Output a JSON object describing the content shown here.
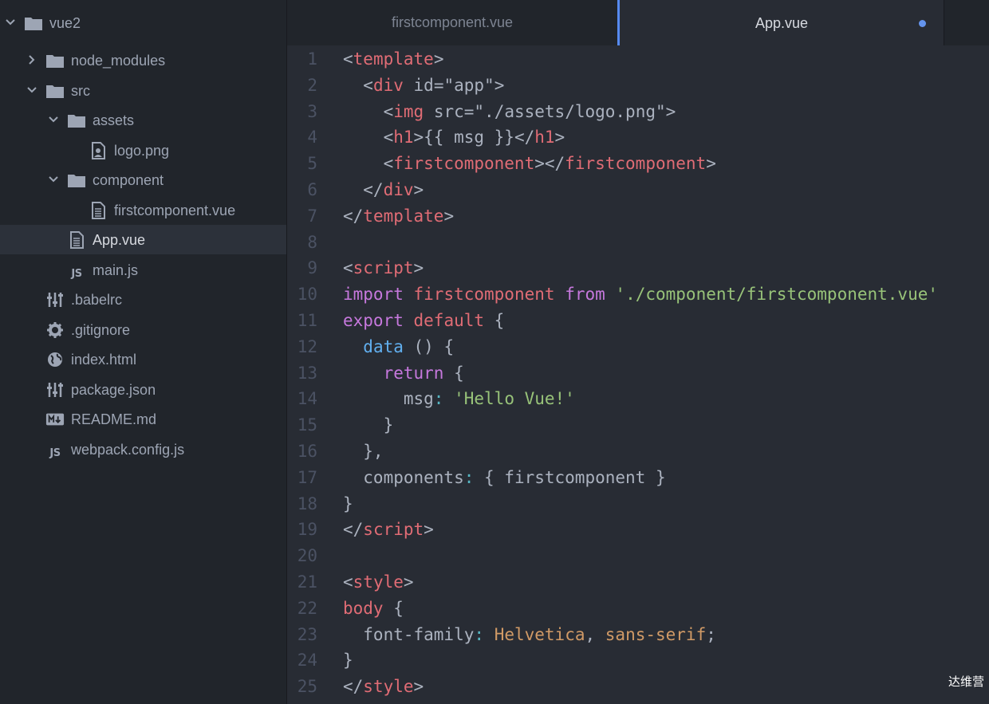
{
  "sidebar": {
    "root": {
      "label": "vue2"
    },
    "items": [
      {
        "label": "node_modules",
        "kind": "folder",
        "state": "collapsed",
        "depth": 1
      },
      {
        "label": "src",
        "kind": "folder",
        "state": "expanded",
        "depth": 1
      },
      {
        "label": "assets",
        "kind": "folder",
        "state": "expanded",
        "depth": 2
      },
      {
        "label": "logo.png",
        "kind": "image-file",
        "depth": 3
      },
      {
        "label": "component",
        "kind": "folder",
        "state": "expanded",
        "depth": 2
      },
      {
        "label": "firstcomponent.vue",
        "kind": "text-file",
        "depth": 3
      },
      {
        "label": "App.vue",
        "kind": "text-file",
        "depth": 2,
        "selected": true
      },
      {
        "label": "main.js",
        "kind": "js-file",
        "depth": 2
      },
      {
        "label": ".babelrc",
        "kind": "config-file",
        "depth": 1
      },
      {
        "label": ".gitignore",
        "kind": "gear-file",
        "depth": 1
      },
      {
        "label": "index.html",
        "kind": "globe-file",
        "depth": 1
      },
      {
        "label": "package.json",
        "kind": "config-file",
        "depth": 1
      },
      {
        "label": "README.md",
        "kind": "markdown-file",
        "depth": 1
      },
      {
        "label": "webpack.config.js",
        "kind": "js-file",
        "depth": 1
      }
    ]
  },
  "tabs": [
    {
      "label": "firstcomponent.vue",
      "active": false
    },
    {
      "label": "App.vue",
      "active": true,
      "modified": true
    }
  ],
  "editor": {
    "lines": [
      [
        [
          "t-punc",
          "<"
        ],
        [
          "t-tag",
          "template"
        ],
        [
          "t-punc",
          ">"
        ]
      ],
      [
        [
          "t-punc",
          "  <"
        ],
        [
          "t-tag",
          "div"
        ],
        [
          "t-punc",
          " "
        ],
        [
          "t-prop",
          "id"
        ],
        [
          "t-punc",
          "="
        ],
        [
          "t-punc",
          "\"app\""
        ],
        [
          "t-punc",
          ">"
        ]
      ],
      [
        [
          "t-punc",
          "    <"
        ],
        [
          "t-tag",
          "img"
        ],
        [
          "t-punc",
          " "
        ],
        [
          "t-prop",
          "src"
        ],
        [
          "t-punc",
          "="
        ],
        [
          "t-punc",
          "\"./assets/logo.png\""
        ],
        [
          "t-punc",
          ">"
        ]
      ],
      [
        [
          "t-punc",
          "    <"
        ],
        [
          "t-tag",
          "h1"
        ],
        [
          "t-punc",
          ">{{ msg }}</"
        ],
        [
          "t-tag",
          "h1"
        ],
        [
          "t-punc",
          ">"
        ]
      ],
      [
        [
          "t-punc",
          "    <"
        ],
        [
          "t-tag",
          "firstcomponent"
        ],
        [
          "t-punc",
          "></"
        ],
        [
          "t-tag",
          "firstcomponent"
        ],
        [
          "t-punc",
          ">"
        ]
      ],
      [
        [
          "t-punc",
          "  </"
        ],
        [
          "t-tag",
          "div"
        ],
        [
          "t-punc",
          ">"
        ]
      ],
      [
        [
          "t-punc",
          "</"
        ],
        [
          "t-tag",
          "template"
        ],
        [
          "t-punc",
          ">"
        ]
      ],
      [],
      [
        [
          "t-punc",
          "<"
        ],
        [
          "t-tag",
          "script"
        ],
        [
          "t-punc",
          ">"
        ]
      ],
      [
        [
          "t-kw",
          "import"
        ],
        [
          "t-punc",
          " "
        ],
        [
          "t-tag",
          "firstcomponent"
        ],
        [
          "t-punc",
          " "
        ],
        [
          "t-kw",
          "from"
        ],
        [
          "t-punc",
          " "
        ],
        [
          "t-str",
          "'./component/firstcomponent.vue'"
        ]
      ],
      [
        [
          "t-kw",
          "export"
        ],
        [
          "t-punc",
          " "
        ],
        [
          "t-tag",
          "default"
        ],
        [
          "t-punc",
          " {"
        ]
      ],
      [
        [
          "t-punc",
          "  "
        ],
        [
          "t-fn",
          "data"
        ],
        [
          "t-punc",
          " () {"
        ]
      ],
      [
        [
          "t-punc",
          "    "
        ],
        [
          "t-kw",
          "return"
        ],
        [
          "t-punc",
          " {"
        ]
      ],
      [
        [
          "t-punc",
          "      msg"
        ],
        [
          "t-op",
          ":"
        ],
        [
          "t-punc",
          " "
        ],
        [
          "t-str",
          "'Hello Vue!'"
        ]
      ],
      [
        [
          "t-punc",
          "    }"
        ]
      ],
      [
        [
          "t-punc",
          "  },"
        ]
      ],
      [
        [
          "t-punc",
          "  components"
        ],
        [
          "t-op",
          ":"
        ],
        [
          "t-punc",
          " { firstcomponent }"
        ]
      ],
      [
        [
          "t-punc",
          "}"
        ]
      ],
      [
        [
          "t-punc",
          "</"
        ],
        [
          "t-tag",
          "script"
        ],
        [
          "t-punc",
          ">"
        ]
      ],
      [],
      [
        [
          "t-punc",
          "<"
        ],
        [
          "t-tag",
          "style"
        ],
        [
          "t-punc",
          ">"
        ]
      ],
      [
        [
          "t-sel",
          "body"
        ],
        [
          "t-punc",
          " {"
        ]
      ],
      [
        [
          "t-punc",
          "  font-family"
        ],
        [
          "t-op",
          ":"
        ],
        [
          "t-punc",
          " "
        ],
        [
          "t-val",
          "Helvetica"
        ],
        [
          "t-punc",
          ", "
        ],
        [
          "t-val",
          "sans-serif"
        ],
        [
          "t-punc",
          ";"
        ]
      ],
      [
        [
          "t-punc",
          "}"
        ]
      ],
      [
        [
          "t-punc",
          "</"
        ],
        [
          "t-tag",
          "style"
        ],
        [
          "t-punc",
          ">"
        ]
      ]
    ]
  },
  "watermark": "达维营",
  "colors": {
    "sidebar_bg": "#21252b",
    "editor_bg": "#282c34",
    "tag": "#e06c75",
    "keyword": "#c678dd",
    "string": "#98c379",
    "function": "#61afef",
    "number_value": "#d19a66",
    "modified_dot": "#6494ed"
  }
}
